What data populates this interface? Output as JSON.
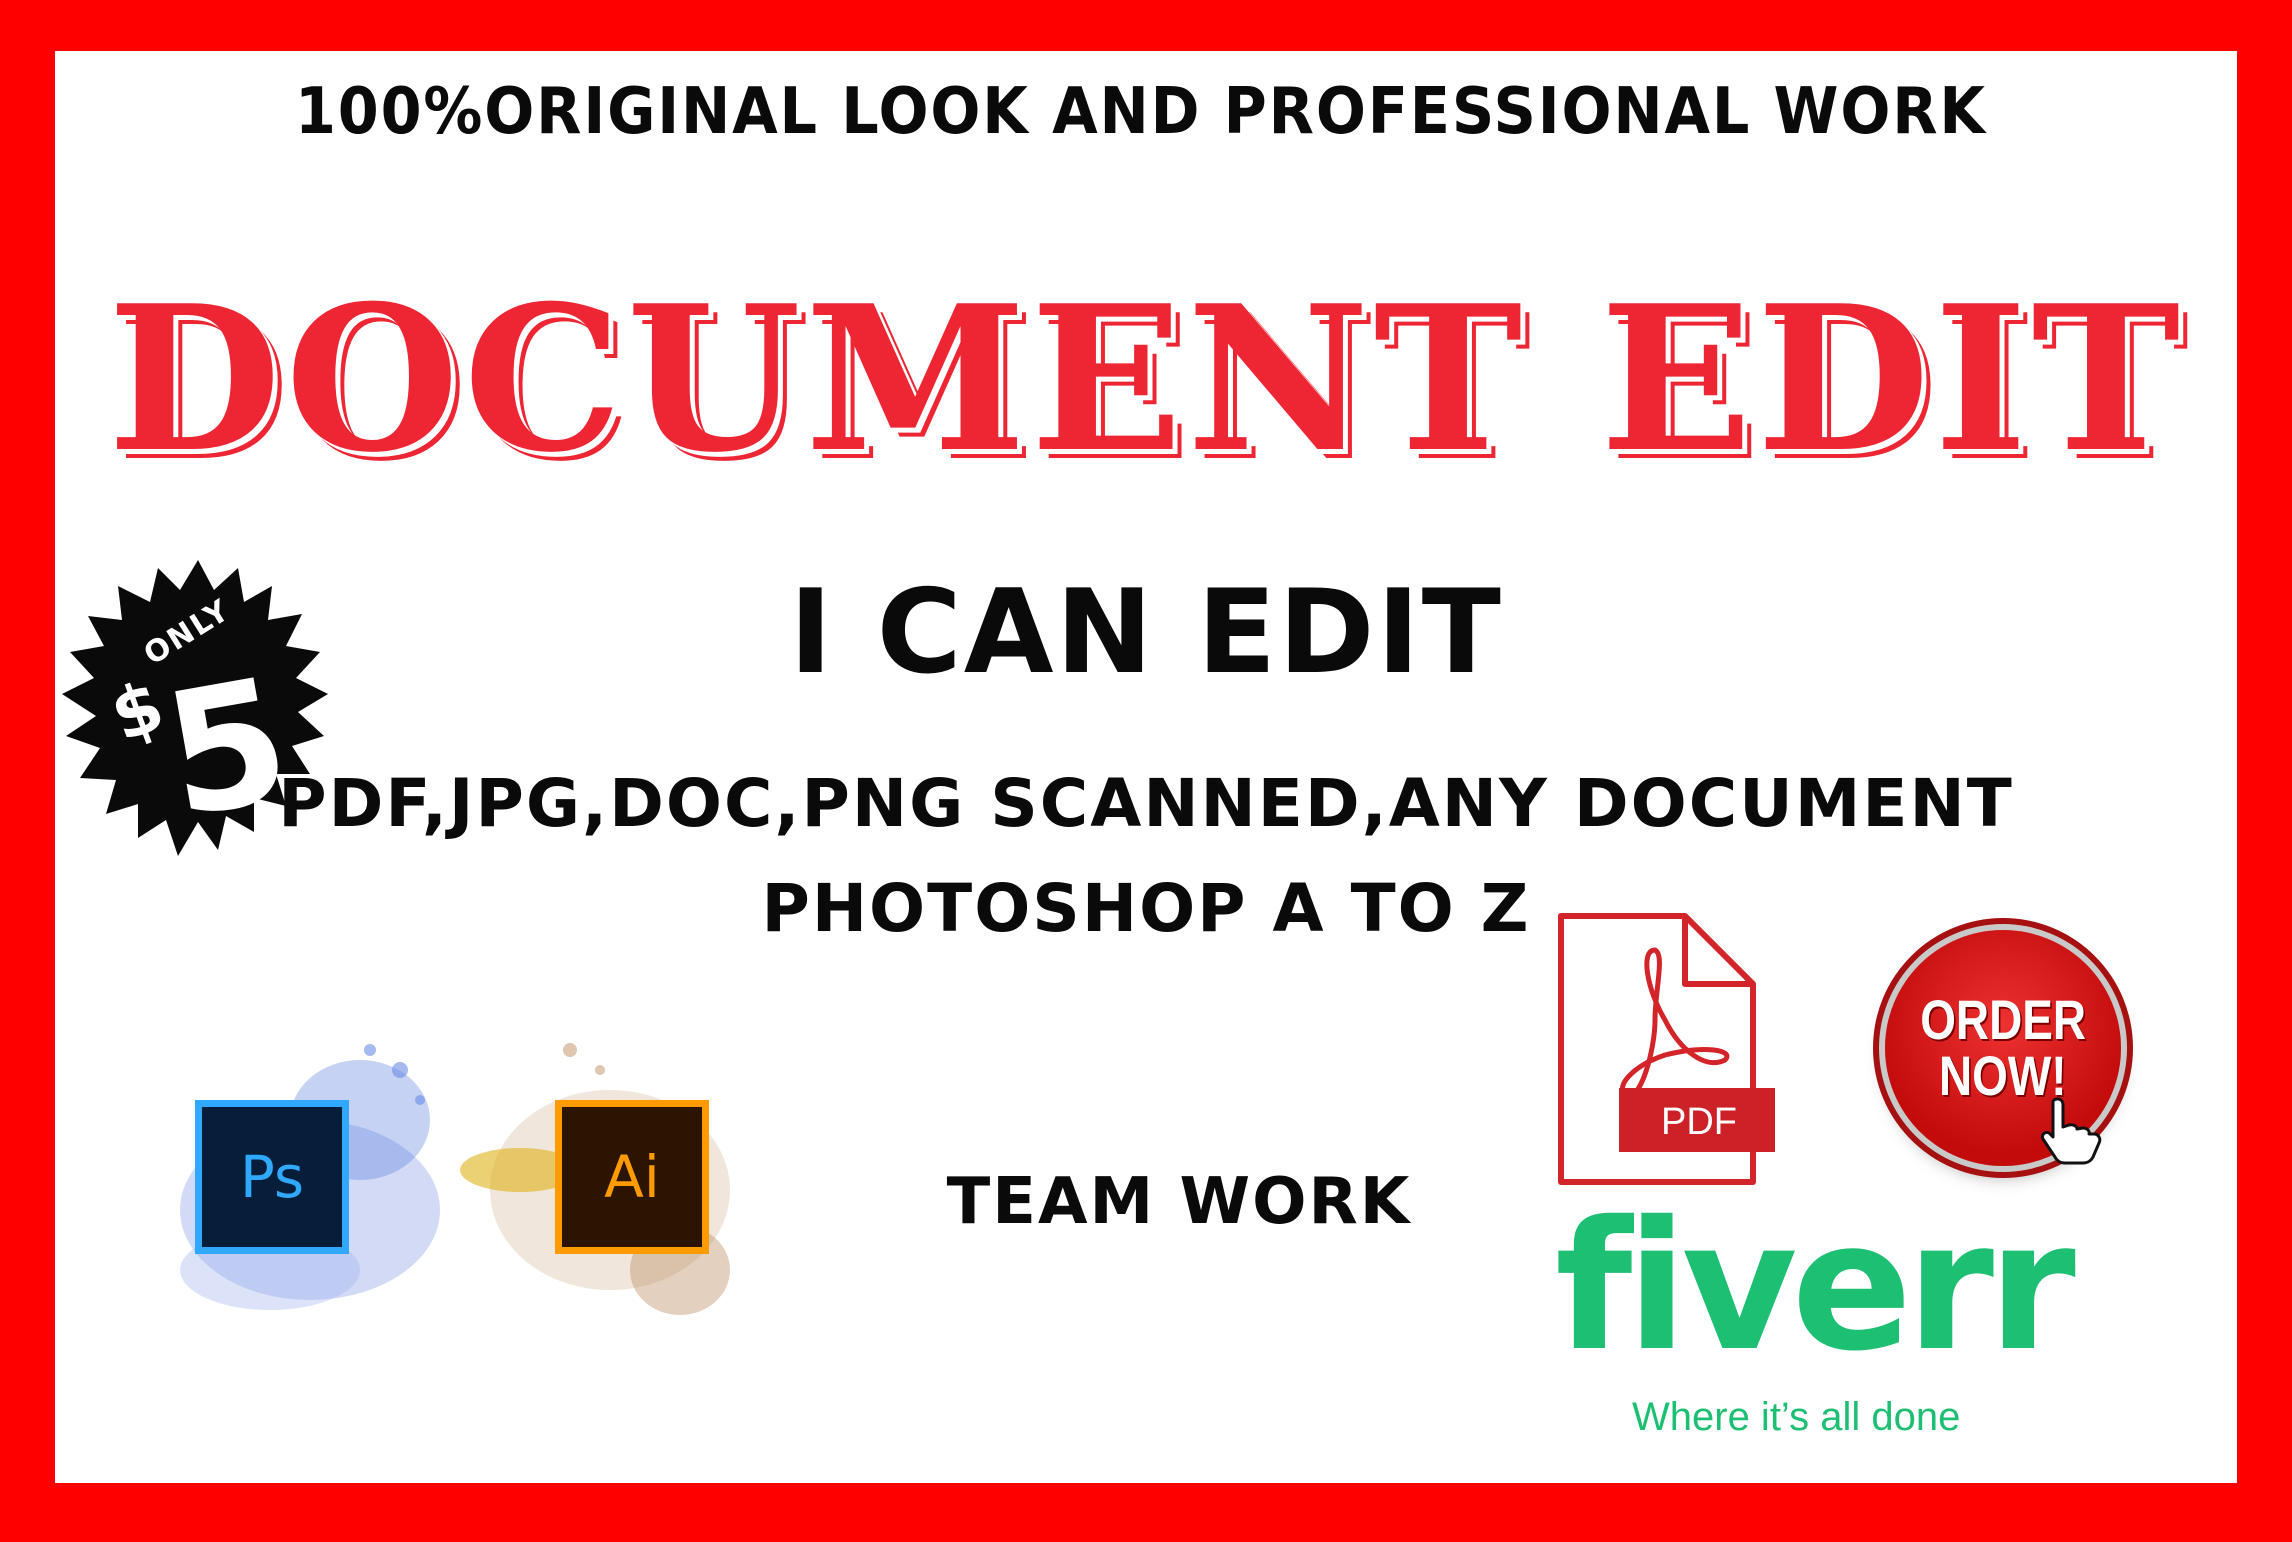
{
  "tagline": "100%ORIGINAL LOOK AND PROFESSIONAL WORK",
  "headline": "DOCUMENT EDIT",
  "subhead": "I CAN EDIT",
  "formats": "PDF,JPG,DOC,PNG SCANNED,ANY DOCUMENT",
  "photoshop": "PHOTOSHOP A TO Z",
  "team_work": "TEAM WORK",
  "price_badge": {
    "only": "ONLY",
    "currency": "$",
    "amount": "5"
  },
  "ps_logo": "Ps",
  "ai_logo": "Ai",
  "pdf_icon_label": "PDF",
  "order_button": {
    "line1": "ORDER",
    "line2": "NOW!"
  },
  "fiverr": {
    "logo": "fiverr",
    "tagline": "Where it’s all done"
  },
  "colors": {
    "frame": "#ff0000",
    "headline": "#ee2633",
    "fiverr_green": "#1dbf73",
    "text": "#0a0a0a"
  },
  "icons": [
    "price-burst-icon",
    "photoshop-icon",
    "illustrator-icon",
    "pdf-file-icon",
    "pointing-hand-icon"
  ]
}
